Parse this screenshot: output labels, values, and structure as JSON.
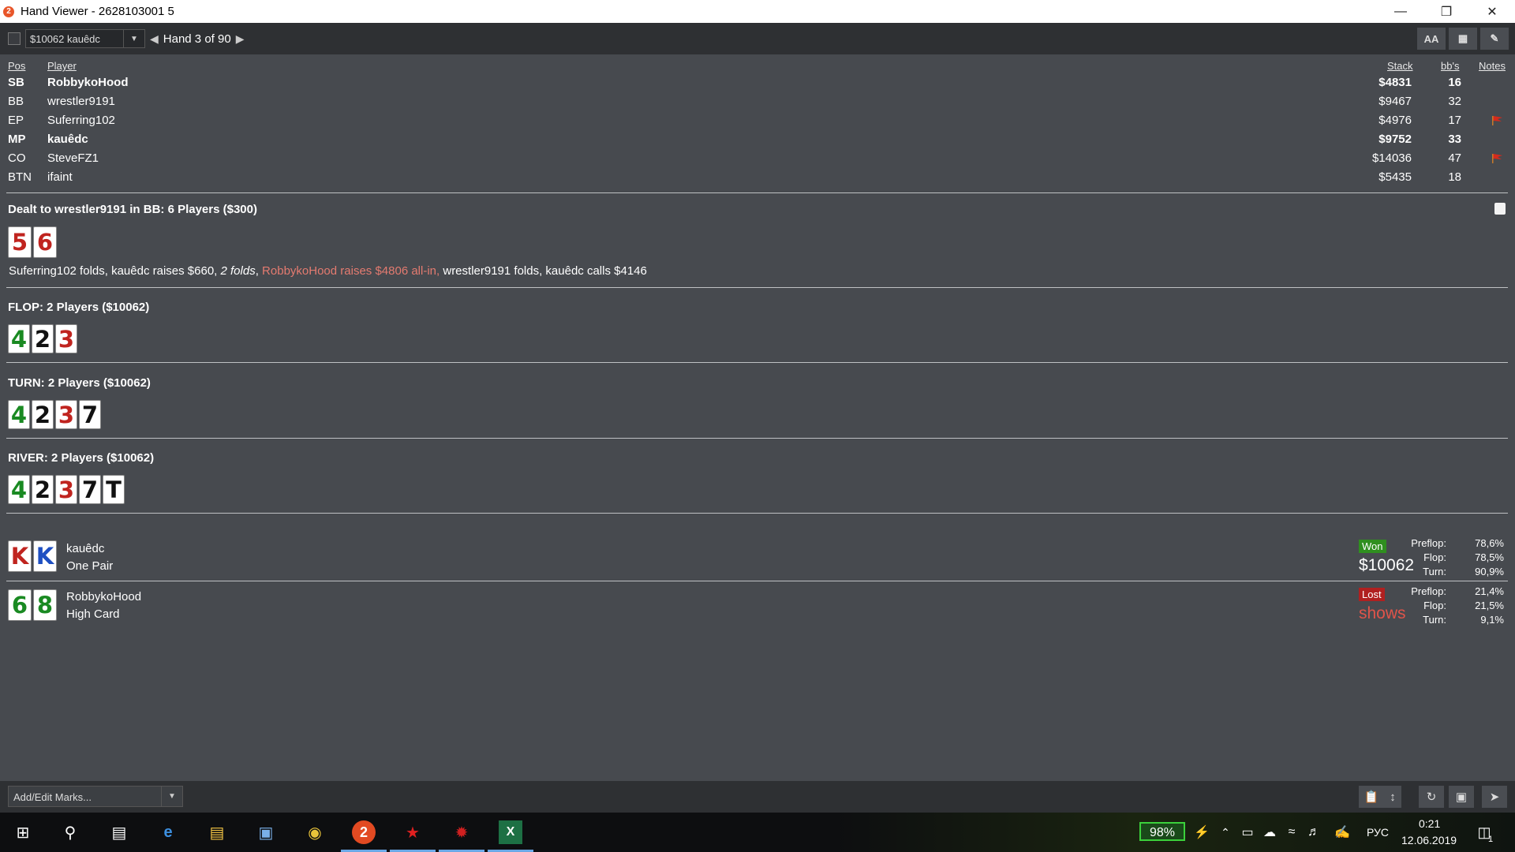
{
  "window": {
    "title": "Hand Viewer - 2628103001 5",
    "app_icon": "2"
  },
  "toolbar": {
    "hand_select": "$10062 kauêdc",
    "hand_label": "Hand 3 of 90",
    "font_button": "AA"
  },
  "table_headers": {
    "pos": "Pos",
    "player": "Player",
    "stack": "Stack",
    "bbs": "bb's",
    "notes": "Notes"
  },
  "players": [
    {
      "pos": "SB",
      "name": "RobbykoHood",
      "stack": "$4831",
      "bbs": "16",
      "bold": true,
      "flag": false
    },
    {
      "pos": "BB",
      "name": "wrestler9191",
      "stack": "$9467",
      "bbs": "32",
      "bold": false,
      "flag": false
    },
    {
      "pos": "EP",
      "name": "Suferring102",
      "stack": "$4976",
      "bbs": "17",
      "bold": false,
      "flag": true
    },
    {
      "pos": "MP",
      "name": "kauêdc",
      "stack": "$9752",
      "bbs": "33",
      "bold": true,
      "flag": false
    },
    {
      "pos": "CO",
      "name": "SteveFZ1",
      "stack": "$14036",
      "bbs": "47",
      "bold": false,
      "flag": true
    },
    {
      "pos": "BTN",
      "name": "ifaint",
      "stack": "$5435",
      "bbs": "18",
      "bold": false,
      "flag": false
    }
  ],
  "preflop": {
    "title": "Dealt to wrestler9191 in BB: 6 Players ($300)",
    "cards": [
      {
        "rank": "5",
        "color": "red"
      },
      {
        "rank": "6",
        "color": "red"
      }
    ],
    "actions": {
      "part1": "Suferring102 folds, kauêdc raises $660, ",
      "part2": "2 folds",
      "part3": ", ",
      "part4": "RobbykoHood raises $4806 all-in,",
      "part5": " wrestler9191 folds, kauêdc calls $4146"
    }
  },
  "flop": {
    "title": "FLOP: 2 Players ($10062)",
    "cards": [
      {
        "rank": "4",
        "color": "green"
      },
      {
        "rank": "2",
        "color": "black"
      },
      {
        "rank": "3",
        "color": "red"
      }
    ]
  },
  "turn": {
    "title": "TURN: 2 Players ($10062)",
    "cards": [
      {
        "rank": "4",
        "color": "green"
      },
      {
        "rank": "2",
        "color": "black"
      },
      {
        "rank": "3",
        "color": "red"
      },
      {
        "rank": "7",
        "color": "black"
      }
    ]
  },
  "river": {
    "title": "RIVER: 2 Players ($10062)",
    "cards": [
      {
        "rank": "4",
        "color": "green"
      },
      {
        "rank": "2",
        "color": "black"
      },
      {
        "rank": "3",
        "color": "red"
      },
      {
        "rank": "7",
        "color": "black"
      },
      {
        "rank": "T",
        "color": "black"
      }
    ]
  },
  "showdown": [
    {
      "name": "kauêdc",
      "hand": "One Pair",
      "cards": [
        {
          "rank": "K",
          "color": "red"
        },
        {
          "rank": "K",
          "color": "blue"
        }
      ],
      "badge": "Won",
      "amount": "$10062",
      "equity": [
        {
          "label": "Preflop:",
          "value": "78,6%"
        },
        {
          "label": "Flop:",
          "value": "78,5%"
        },
        {
          "label": "Turn:",
          "value": "90,9%"
        }
      ]
    },
    {
      "name": "RobbykoHood",
      "hand": "High Card",
      "cards": [
        {
          "rank": "6",
          "color": "green"
        },
        {
          "rank": "8",
          "color": "green"
        }
      ],
      "badge": "Lost",
      "amount": "shows",
      "equity": [
        {
          "label": "Preflop:",
          "value": "21,4%"
        },
        {
          "label": "Flop:",
          "value": "21,5%"
        },
        {
          "label": "Turn:",
          "value": "9,1%"
        }
      ]
    }
  ],
  "bottom": {
    "marks_placeholder": "Add/Edit Marks..."
  },
  "taskbar": {
    "battery": "98%",
    "lang": "РУС",
    "time": "0:21",
    "date": "12.06.2019",
    "notif_count": "1"
  }
}
